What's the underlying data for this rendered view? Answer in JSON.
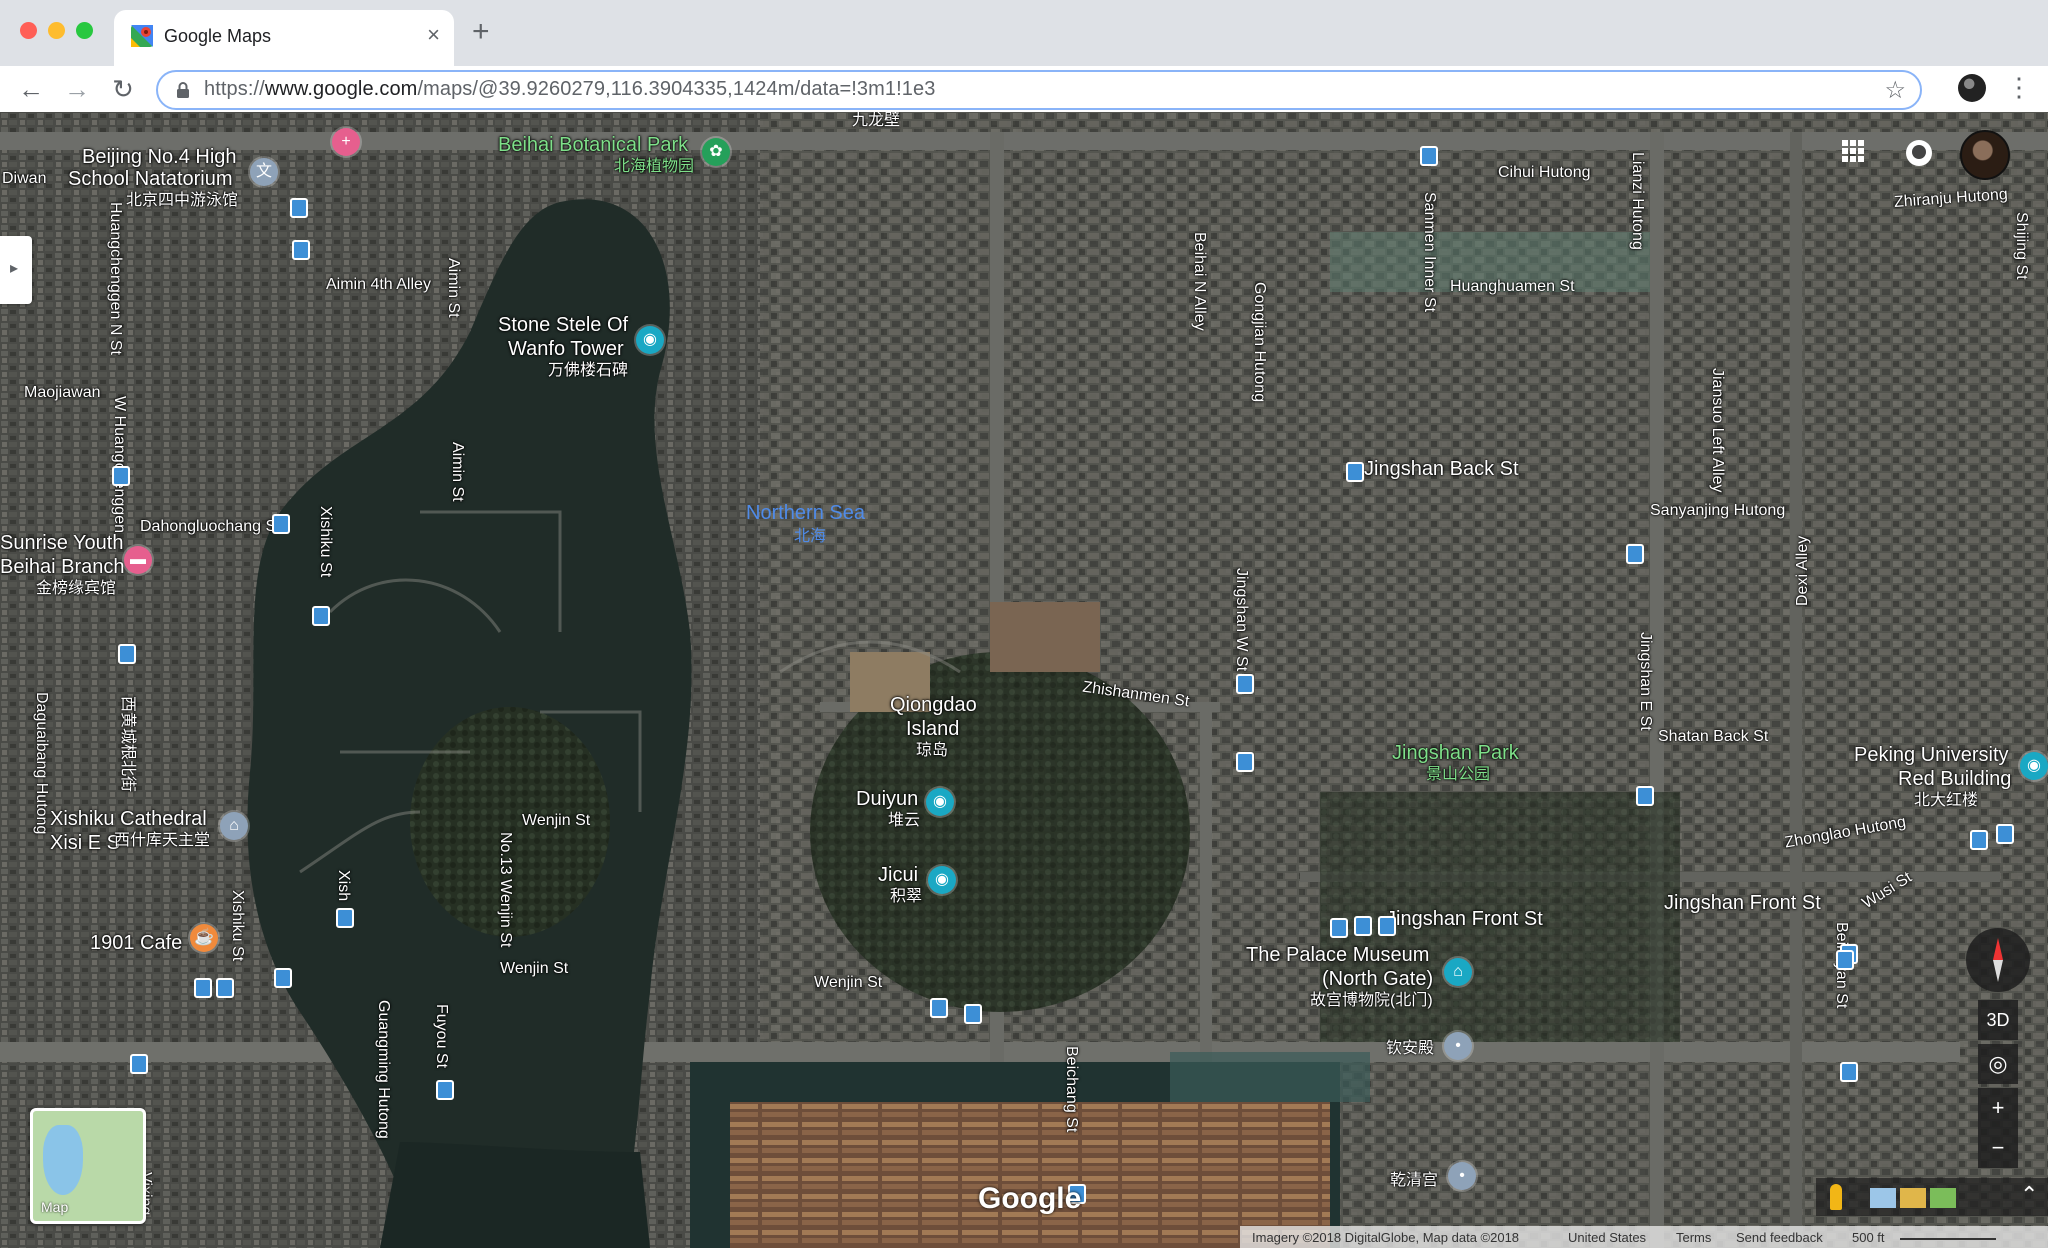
{
  "browser": {
    "tab_title": "Google Maps",
    "tab_close": "×",
    "new_tab": "+",
    "url_scheme": "https://",
    "url_host": "www.google.com",
    "url_path": "/maps/@39.9260279,116.3904335,1424m/data=!3m1!1e3",
    "back": "←",
    "forward": "→",
    "reload": "↻",
    "star": "☆",
    "menu": "⋮"
  },
  "map": {
    "labels": {
      "beijing_no4": "Beijing No.4 High",
      "school_natatorium": "School Natatorium",
      "natatorium_cn": "北京四中游泳馆",
      "beihai_botanical": "Beihai Botanical Park",
      "beihai_botanical_cn": "北海植物园",
      "jiulongbi_cn": "九龙壁",
      "aimin_4th": "Aimin 4th Alley",
      "aimin_st_1": "Aimin St",
      "aimin_st_2": "Aimin St",
      "stone_stele_1": "Stone Stele Of",
      "stone_stele_2": "Wanfo Tower",
      "stone_stele_cn": "万佛楼石碑",
      "maojiawan": "Maojiawan",
      "diwan": "Diwan",
      "huangchenggen_n": "Huangchenggen N St",
      "w_huangchenggen": "W Huangchenggen",
      "dahongluochang": "Dahongluochang St",
      "sunrise_1": "Sunrise Youth",
      "sunrise_2": "Beihai Branch",
      "sunrise_cn": "金榜缘宾馆",
      "xishiku_st": "Xishiku St",
      "northern_sea": "Northern Sea",
      "northern_sea_cn": "北海",
      "daguailiang": "Daguaibang Hutong",
      "xihuangchenggen_cn": "西黄城根北街",
      "xishiku_cathedral": "Xishiku Cathedral",
      "xishiku_cathedral_2": "Xisi E S",
      "xishiku_cathedral_cn": "西什库天主堂",
      "cafe_1901": "1901 Cafe",
      "xishiku_st_2": "Xishiku St",
      "xish": "Xish",
      "no13_wenjin": "No.13 Wenjin St",
      "wenjin_st": "Wenjin St",
      "wenjin_st_2": "Wenjin St",
      "wenjin_st_3": "Wenjin St",
      "guangming_hutong": "Guangming Hutong",
      "fuyou_st": "Fuyou St",
      "qiongdao_1": "Qiongdao",
      "qiongdao_2": "Island",
      "qiongdao_cn": "琼岛",
      "duiyun": "Duiyun",
      "duiyun_cn": "堆云",
      "jicui": "Jicui",
      "jicui_cn": "积翠",
      "zhishanmen": "Zhishanmen St",
      "beichang_st": "Beichang St",
      "cihui": "Cihui Hutong",
      "lianzi": "Lianzi Hutong",
      "sanmen_inner": "Sanmen Inner St",
      "huanghuamen": "Huanghuamen St",
      "beihai_n_alley": "Beihai N Alley",
      "gongjian": "Gongjian Hutong",
      "jingshan_back": "Jingshan Back St",
      "jianshu_left": "Jiansuo Left Alley",
      "sanyanjing": "Sanyanjing Hutong",
      "dexi": "Dexi Alley",
      "jingshan_w": "Jingshan W St",
      "jingshan_e": "Jingshan E St",
      "shatan_back": "Shatan Back St",
      "jingshan_park": "Jingshan Park",
      "jingshan_park_cn": "景山公园",
      "peking_1": "Peking University",
      "peking_2": "Red Building",
      "peking_cn": "北大红楼",
      "zhonglao": "Zhonglao Hutong",
      "wusi": "Wusi St",
      "jingshan_front": "Jingshan Front St",
      "jingshan_front_2": "Jingshan Front St",
      "palace_1": "The Palace Museum",
      "palace_2": "(North Gate)",
      "palace_cn": "故宫博物院(北门)",
      "qinandian_cn": "钦安殿",
      "qianqinggong_cn": "乾清宫",
      "beiheyan": "Beiheyan St",
      "zhiranju": "Zhiranju Hutong",
      "shijing": "Shijing St",
      "vixing": "Vixing"
    },
    "minimap_label": "Map",
    "three_d": "3D",
    "zoom_in": "+",
    "zoom_out": "−",
    "google_logo": "Google",
    "footer": {
      "imagery": "Imagery ©2018 DigitalGlobe, Map data ©2018",
      "country": "United States",
      "terms": "Terms",
      "feedback": "Send feedback",
      "scale": "500 ft"
    }
  }
}
